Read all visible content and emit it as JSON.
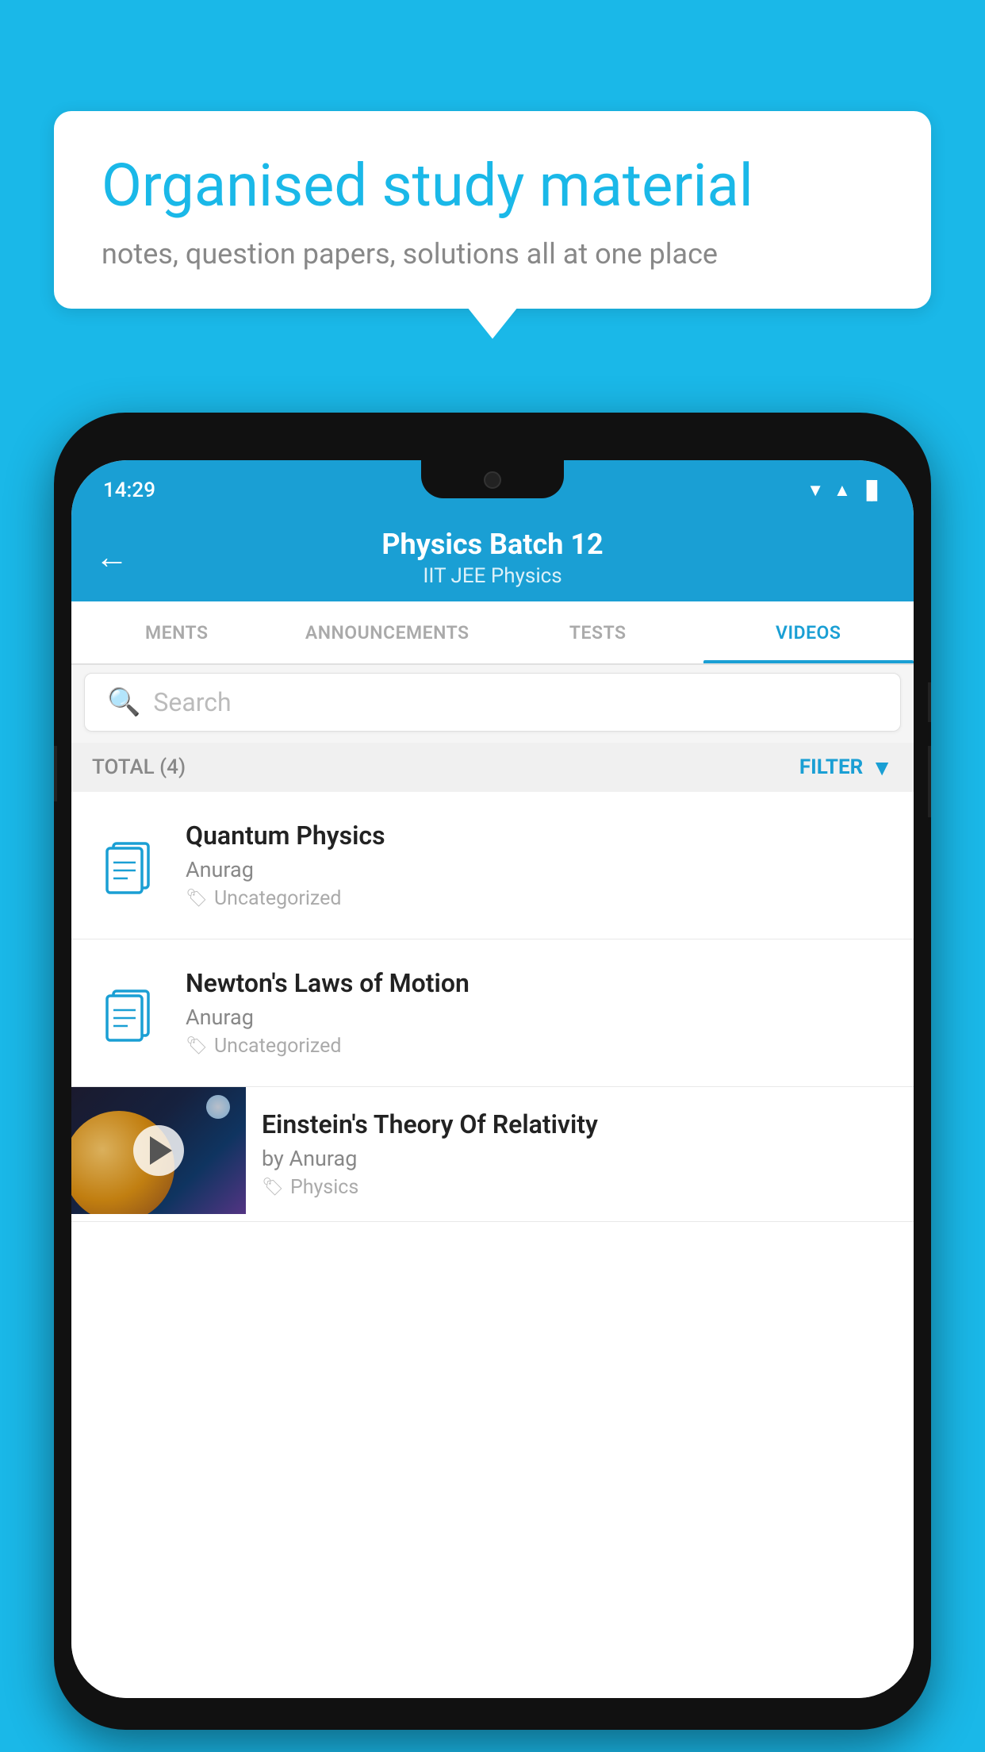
{
  "background_color": "#1ab8e8",
  "bubble": {
    "title": "Organised study material",
    "subtitle": "notes, question papers, solutions all at one place"
  },
  "status_bar": {
    "time": "14:29",
    "wifi": "▼",
    "signal": "▲",
    "battery": "▌"
  },
  "app_bar": {
    "title": "Physics Batch 12",
    "subtitle_tags": "IIT JEE   Physics"
  },
  "tabs": [
    {
      "label": "MENTS",
      "active": false
    },
    {
      "label": "ANNOUNCEMENTS",
      "active": false
    },
    {
      "label": "TESTS",
      "active": false
    },
    {
      "label": "VIDEOS",
      "active": true
    }
  ],
  "search": {
    "placeholder": "Search"
  },
  "filter_bar": {
    "total_label": "TOTAL (4)",
    "filter_label": "FILTER"
  },
  "videos": [
    {
      "title": "Quantum Physics",
      "author": "Anurag",
      "tag": "Uncategorized",
      "has_thumb": false
    },
    {
      "title": "Newton's Laws of Motion",
      "author": "Anurag",
      "tag": "Uncategorized",
      "has_thumb": false
    },
    {
      "title": "Einstein's Theory Of Relativity",
      "author": "by Anurag",
      "tag": "Physics",
      "has_thumb": true
    }
  ]
}
